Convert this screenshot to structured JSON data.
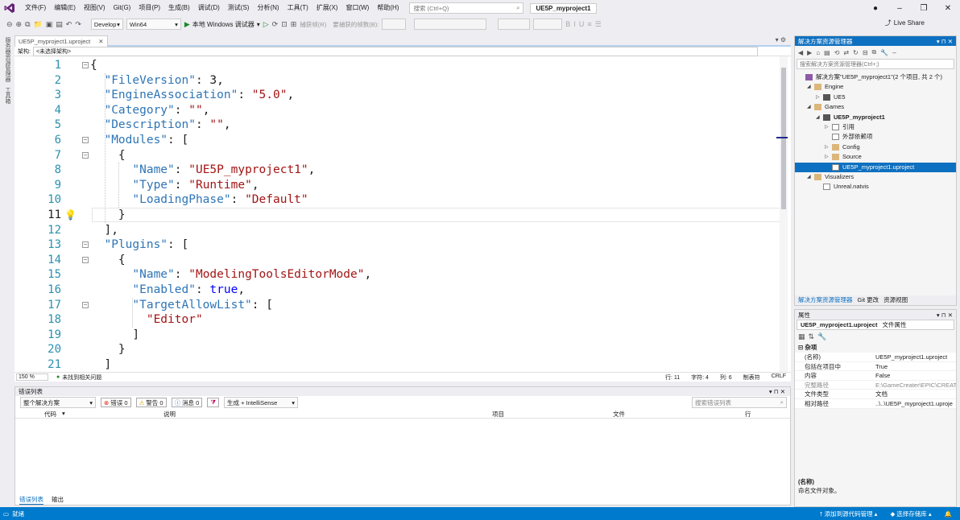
{
  "menu": {
    "items": [
      "文件(F)",
      "编辑(E)",
      "视图(V)",
      "Git(G)",
      "项目(P)",
      "生成(B)",
      "调试(D)",
      "测试(S)",
      "分析(N)",
      "工具(T)",
      "扩展(X)",
      "窗口(W)",
      "帮助(H)"
    ],
    "search_placeholder": "搜索 (Ctrl+Q)",
    "project_title": "UE5P_myproject1"
  },
  "toolbar": {
    "config": "Develop",
    "platform": "Win64",
    "run_label": "本地 Windows 调试器",
    "capture_frame": "捕获帧(R)",
    "frames_label": "要捕获的帧数(B):",
    "live_share": "Live Share"
  },
  "left_strip": {
    "items": [
      "服务器资源管理器",
      "工具箱"
    ]
  },
  "doc_tab": {
    "label": "UE5P_myproject1.uproject"
  },
  "nav": {
    "label": "架构:",
    "value": "<未选择架构>"
  },
  "editor": {
    "line_numbers": [
      "1",
      "2",
      "3",
      "4",
      "5",
      "6",
      "7",
      "8",
      "9",
      "10",
      "11",
      "12",
      "13",
      "14",
      "15",
      "16",
      "17",
      "18",
      "19",
      "20",
      "21"
    ],
    "lines": [
      [
        {
          "t": "{",
          "c": "n"
        }
      ],
      [
        {
          "t": "  \"FileVersion\"",
          "c": "k"
        },
        {
          "t": ": 3,",
          "c": "n"
        }
      ],
      [
        {
          "t": "  \"EngineAssociation\"",
          "c": "k"
        },
        {
          "t": ": ",
          "c": "n"
        },
        {
          "t": "\"5.0\"",
          "c": "s"
        },
        {
          "t": ",",
          "c": "n"
        }
      ],
      [
        {
          "t": "  \"Category\"",
          "c": "k"
        },
        {
          "t": ": ",
          "c": "n"
        },
        {
          "t": "\"\"",
          "c": "s"
        },
        {
          "t": ",",
          "c": "n"
        }
      ],
      [
        {
          "t": "  \"Description\"",
          "c": "k"
        },
        {
          "t": ": ",
          "c": "n"
        },
        {
          "t": "\"\"",
          "c": "s"
        },
        {
          "t": ",",
          "c": "n"
        }
      ],
      [
        {
          "t": "  \"Modules\"",
          "c": "k"
        },
        {
          "t": ": [",
          "c": "n"
        }
      ],
      [
        {
          "t": "    {",
          "c": "n"
        }
      ],
      [
        {
          "t": "      \"Name\"",
          "c": "k"
        },
        {
          "t": ": ",
          "c": "n"
        },
        {
          "t": "\"UE5P_myproject1\"",
          "c": "s"
        },
        {
          "t": ",",
          "c": "n"
        }
      ],
      [
        {
          "t": "      \"Type\"",
          "c": "k"
        },
        {
          "t": ": ",
          "c": "n"
        },
        {
          "t": "\"Runtime\"",
          "c": "s"
        },
        {
          "t": ",",
          "c": "n"
        }
      ],
      [
        {
          "t": "      \"LoadingPhase\"",
          "c": "k"
        },
        {
          "t": ": ",
          "c": "n"
        },
        {
          "t": "\"Default\"",
          "c": "s"
        }
      ],
      [
        {
          "t": "    }",
          "c": "n"
        }
      ],
      [
        {
          "t": "  ],",
          "c": "n"
        }
      ],
      [
        {
          "t": "  \"Plugins\"",
          "c": "k"
        },
        {
          "t": ": [",
          "c": "n"
        }
      ],
      [
        {
          "t": "    {",
          "c": "n"
        }
      ],
      [
        {
          "t": "      \"Name\"",
          "c": "k"
        },
        {
          "t": ": ",
          "c": "n"
        },
        {
          "t": "\"ModelingToolsEditorMode\"",
          "c": "s"
        },
        {
          "t": ",",
          "c": "n"
        }
      ],
      [
        {
          "t": "      \"Enabled\"",
          "c": "k"
        },
        {
          "t": ": ",
          "c": "n"
        },
        {
          "t": "true",
          "c": "b"
        },
        {
          "t": ",",
          "c": "n"
        }
      ],
      [
        {
          "t": "      \"TargetAllowList\"",
          "c": "k"
        },
        {
          "t": ": [",
          "c": "n"
        }
      ],
      [
        {
          "t": "        \"Editor\"",
          "c": "s"
        }
      ],
      [
        {
          "t": "      ]",
          "c": "n"
        }
      ],
      [
        {
          "t": "    }",
          "c": "n"
        }
      ],
      [
        {
          "t": "  ]",
          "c": "n"
        }
      ]
    ]
  },
  "status_line": {
    "zoom": "150 %",
    "issues": "未找到相关问题",
    "row": "行: 11",
    "char": "字符: 4",
    "col": "列: 6",
    "tab": "制表符",
    "eol": "CRLF"
  },
  "error_list": {
    "title": "错误列表",
    "scope": "整个解决方案",
    "errors": "错误 0",
    "warnings": "警告 0",
    "messages": "消息 0",
    "build": "生成 + IntelliSense",
    "search": "搜索错误列表",
    "columns": [
      "代码",
      "说明",
      "项目",
      "文件",
      "行"
    ]
  },
  "bottom_tabs": [
    "错误列表",
    "输出"
  ],
  "solution": {
    "title": "解决方案资源管理器",
    "search": "搜索解决方案资源管理器(Ctrl+;)",
    "items": [
      {
        "label": "解决方案\"UE5P_myproject1\"(2 个项目, 共 2 个)",
        "lvl": 0,
        "arr": "",
        "ic": "solic"
      },
      {
        "label": "Engine",
        "lvl": 1,
        "arr": "◢",
        "ic": "folder"
      },
      {
        "label": "UE5",
        "lvl": 2,
        "arr": "▷",
        "ic": "projic"
      },
      {
        "label": "Games",
        "lvl": 1,
        "arr": "◢",
        "ic": "folder"
      },
      {
        "label": "UE5P_myproject1",
        "lvl": 2,
        "arr": "◢",
        "ic": "projic",
        "bold": true
      },
      {
        "label": "引用",
        "lvl": 3,
        "arr": "▷",
        "ic": "fileic"
      },
      {
        "label": "外部依赖项",
        "lvl": 3,
        "arr": "",
        "ic": "fileic"
      },
      {
        "label": "Config",
        "lvl": 3,
        "arr": "▷",
        "ic": "folder"
      },
      {
        "label": "Source",
        "lvl": 3,
        "arr": "▷",
        "ic": "folder"
      },
      {
        "label": "UE5P_myproject1.uproject",
        "lvl": 3,
        "arr": "",
        "ic": "fileic",
        "sel": true
      },
      {
        "label": "Visualizers",
        "lvl": 1,
        "arr": "◢",
        "ic": "folder"
      },
      {
        "label": "Unreal.natvis",
        "lvl": 2,
        "arr": "",
        "ic": "fileic"
      }
    ],
    "tabs": [
      "解决方案资源管理器",
      "Git 更改",
      "资源视图"
    ]
  },
  "properties": {
    "title": "属性",
    "object": "UE5P_myproject1.uproject",
    "object_type": "文件属性",
    "category": "杂项",
    "rows": [
      {
        "k": "(名称)",
        "v": "UE5P_myproject1.uproject",
        "grey": false
      },
      {
        "k": "包括在项目中",
        "v": "True",
        "grey": false
      },
      {
        "k": "内容",
        "v": "False",
        "grey": false
      },
      {
        "k": "完整路径",
        "v": "E:\\GameCreater\\EPIC\\CREAT",
        "grey": true
      },
      {
        "k": "文件类型",
        "v": "文档",
        "grey": false
      },
      {
        "k": "相对路径",
        "v": "..\\..\\UE5P_myproject1.uproje",
        "grey": false
      }
    ],
    "desc_title": "(名称)",
    "desc_text": "命名文件对象。"
  },
  "statusbar": {
    "ready": "就绪",
    "add_source": "添加到源代码管理",
    "select_repo": "选择存储库"
  }
}
